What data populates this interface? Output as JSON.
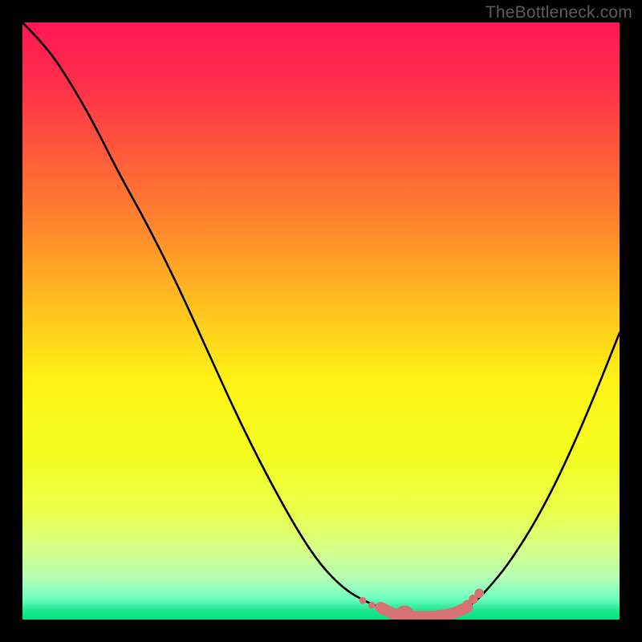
{
  "watermark": "TheBottleneck.com",
  "colors": {
    "frame": "#000000",
    "curve": "#000000",
    "marker_fill": "#d57272",
    "marker_stroke": "#d57272"
  },
  "gradient_stops": [
    {
      "offset": 0.0,
      "color": "#ff1754"
    },
    {
      "offset": 0.1,
      "color": "#ff2e4b"
    },
    {
      "offset": 0.22,
      "color": "#ff5a3a"
    },
    {
      "offset": 0.35,
      "color": "#ff8b2c"
    },
    {
      "offset": 0.48,
      "color": "#ffc31e"
    },
    {
      "offset": 0.6,
      "color": "#fff215"
    },
    {
      "offset": 0.72,
      "color": "#f4ff20"
    },
    {
      "offset": 0.82,
      "color": "#eaff4a"
    },
    {
      "offset": 0.88,
      "color": "#d7ff85"
    },
    {
      "offset": 0.93,
      "color": "#b6ffb6"
    },
    {
      "offset": 0.965,
      "color": "#6dffc1"
    },
    {
      "offset": 0.985,
      "color": "#1be68e"
    },
    {
      "offset": 1.0,
      "color": "#00e27f"
    }
  ],
  "chart_data": {
    "type": "line",
    "title": "",
    "xlabel": "",
    "ylabel": "",
    "xlim": [
      0,
      100
    ],
    "ylim": [
      0,
      100
    ],
    "series": [
      {
        "name": "bottleneck-curve",
        "x": [
          0,
          4,
          8,
          12,
          16,
          21,
          26,
          31,
          36,
          41,
          46,
          50,
          54,
          57.5,
          60,
          62,
          65,
          69,
          72,
          74.5,
          77,
          82,
          88,
          94,
          100
        ],
        "y": [
          100,
          96,
          90,
          83,
          75,
          66,
          56,
          45,
          34,
          24,
          15,
          9,
          5,
          3,
          2,
          1,
          0.5,
          0.5,
          1,
          2,
          4,
          10,
          20,
          33,
          48
        ]
      }
    ],
    "markers": {
      "name": "highlight-band",
      "x": [
        57,
        58.5,
        64,
        72,
        73.5,
        74.5,
        75.5,
        76.5
      ],
      "y": [
        3.2,
        2.4,
        0.8,
        1.2,
        1.8,
        2.5,
        3.4,
        4.4
      ],
      "r": [
        4.5,
        4.5,
        12,
        6,
        6,
        6,
        6,
        6
      ]
    }
  }
}
